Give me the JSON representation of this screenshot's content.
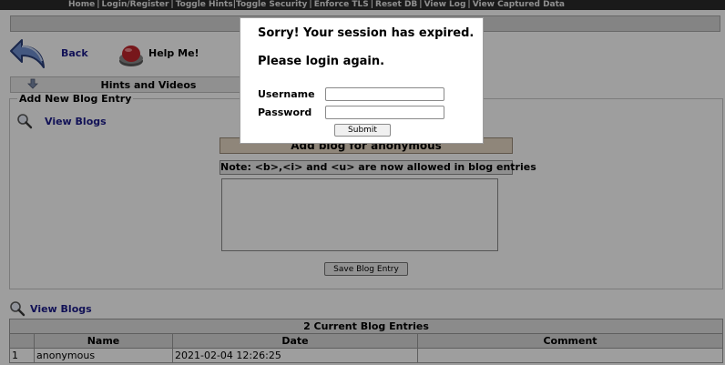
{
  "nav": {
    "items": [
      "Home",
      "Login/Register",
      "Toggle Hints",
      "Toggle Security",
      "Enforce TLS",
      "Reset DB",
      "View Log",
      "View Captured Data"
    ]
  },
  "toolbar": {
    "back_label": "Back",
    "help_label": "Help Me!",
    "back_icon": "back-arrow-icon",
    "help_icon": "help-button-icon"
  },
  "hints": {
    "label": "Hints and Videos",
    "icon": "down-arrow-icon"
  },
  "add_blog": {
    "legend": "Add New Blog Entry",
    "view_blogs_label": "View Blogs",
    "view_icon": "magnifier-icon",
    "heading": "Add blog for anonymous",
    "note": "Note: <b>,<i> and <u> are now allowed in blog entries",
    "textarea_value": "",
    "save_label": "Save Blog Entry"
  },
  "view_blogs_link": "View Blogs",
  "blog_table": {
    "caption": "2 Current Blog Entries",
    "headers": [
      "",
      "Name",
      "Date",
      "Comment"
    ],
    "rows": [
      [
        "1",
        "anonymous",
        "2021-02-04 12:26:25",
        ""
      ]
    ]
  },
  "modal": {
    "title": "Sorry! Your session has expired.",
    "subtitle": "Please login again.",
    "username_label": "Username",
    "password_label": "Password",
    "username_value": "",
    "password_value": "",
    "submit_label": "Submit"
  },
  "colors": {
    "nav_bg": "#2b2b2b",
    "link": "#1c1c8c",
    "overlay": "rgba(0,0,0,0.38)",
    "blog_heading_bg": "#e7d8c6"
  }
}
